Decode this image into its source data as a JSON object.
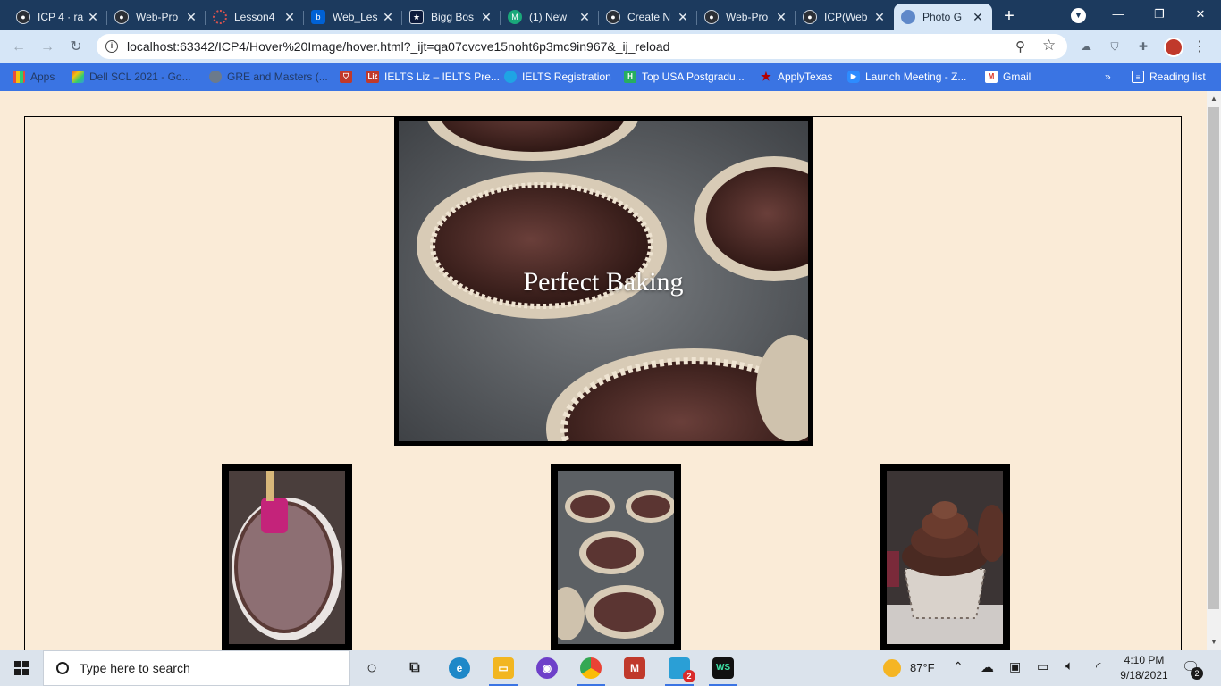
{
  "browser": {
    "tabs": [
      {
        "title": "ICP 4 · ra",
        "icon": "github-icon",
        "icon_color": "#2b2f36"
      },
      {
        "title": "Web-Pro",
        "icon": "github-icon",
        "icon_color": "#2b2f36"
      },
      {
        "title": "Lesson4",
        "icon": "spinner-icon",
        "icon_color": "#d9534f"
      },
      {
        "title": "Web_Les",
        "icon": "box-icon",
        "icon_color": "#0061d5"
      },
      {
        "title": "Bigg Bos",
        "icon": "hotstar-icon",
        "icon_color": "#0c1a3b"
      },
      {
        "title": "(1) New",
        "icon": "medium-icon",
        "icon_color": "#1aa87a"
      },
      {
        "title": "Create N",
        "icon": "github-icon",
        "icon_color": "#2b2f36"
      },
      {
        "title": "Web-Pro",
        "icon": "github-icon",
        "icon_color": "#2b2f36"
      },
      {
        "title": "ICP(Web",
        "icon": "github-icon",
        "icon_color": "#2b2f36"
      },
      {
        "title": "Photo G",
        "icon": "globe-icon",
        "icon_color": "#5f88c9",
        "active": true
      }
    ],
    "url": "localhost:63342/ICP4/Hover%20Image/hover.html?_ijt=qa07cvcve15noht6p3mc9in967&_ij_reload",
    "bookmarks": [
      {
        "label": "Apps",
        "icon": "apps-icon",
        "dim": true
      },
      {
        "label": "Dell SCL 2021 - Go...",
        "icon": "colors-icon",
        "dim": true
      },
      {
        "label": "GRE and Masters (...",
        "icon": "globe-icon",
        "dim": true
      },
      {
        "label": "",
        "icon": "shield-icon",
        "dim": false
      },
      {
        "label": "IELTS Liz – IELTS Pre...",
        "icon": "liz-icon",
        "dim": false
      },
      {
        "label": "IELTS Registration",
        "icon": "clover-icon",
        "dim": false
      },
      {
        "label": "Top USA Postgradu...",
        "icon": "h-icon",
        "dim": false
      },
      {
        "label": "ApplyTexas",
        "icon": "star-icon",
        "dim": false
      },
      {
        "label": "Launch Meeting - Z...",
        "icon": "zoom-icon",
        "dim": false
      },
      {
        "label": "Gmail",
        "icon": "gmail-icon",
        "dim": false
      }
    ],
    "more_bookmarks": "»",
    "reading_list": "Reading list"
  },
  "page": {
    "hero_caption": "Perfect Baking",
    "thumbnails": [
      {
        "name": "mixing-bowl-thumbnail",
        "subject": "chocolate batter in bowl with spatula"
      },
      {
        "name": "muffin-tin-thumbnail",
        "subject": "cupcake liners in muffin tin"
      },
      {
        "name": "cupcake-thumbnail",
        "subject": "frosted chocolate cupcake"
      }
    ]
  },
  "taskbar": {
    "search_placeholder": "Type here to search",
    "weather": "87°F",
    "time": "4:10 PM",
    "date": "9/18/2021",
    "notification_count": "2",
    "chat_badge": "2"
  }
}
